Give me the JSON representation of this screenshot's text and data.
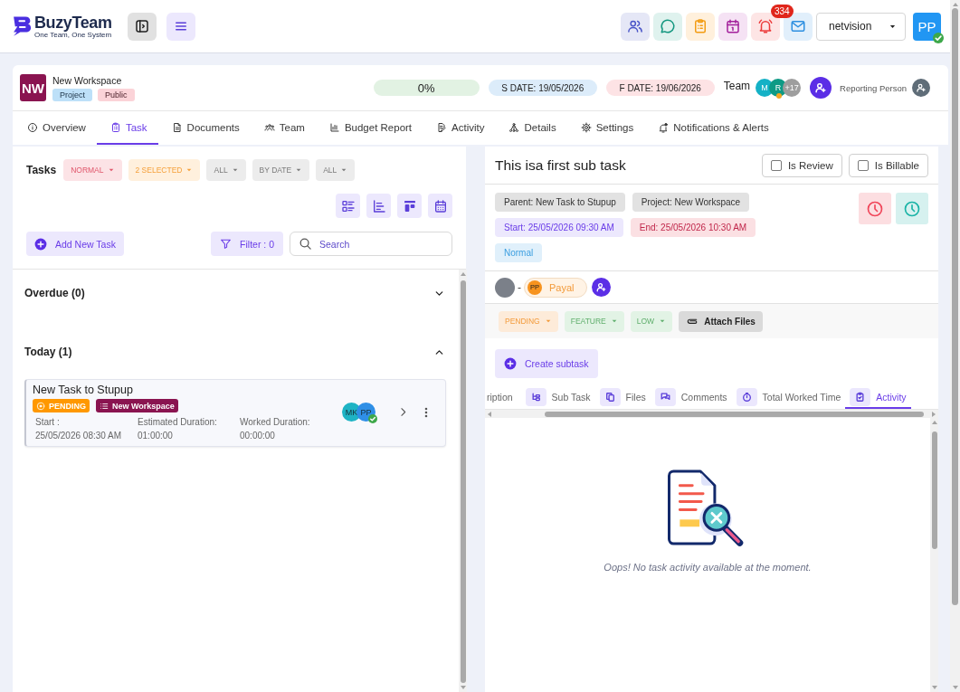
{
  "top_bar": {
    "brand": "BuzyTeam",
    "tagline": "One Team, One System",
    "actions": [
      {
        "kind": "team"
      },
      {
        "kind": "chat"
      },
      {
        "kind": "tasks"
      },
      {
        "kind": "calendar"
      },
      {
        "kind": "notifications",
        "badge": "334"
      },
      {
        "kind": "mail"
      }
    ],
    "workspace_select": {
      "value": "netvision"
    },
    "user": {
      "initials": "PP",
      "verified": true
    }
  },
  "workspace": {
    "initials": "NW",
    "name": "New Workspace",
    "tags": [
      {
        "label": "Project",
        "kind": "type"
      },
      {
        "label": "Public",
        "kind": "visibility"
      }
    ],
    "progress": "0%",
    "start_date": "S DATE: 19/05/2026",
    "finish_date": "F DATE: 19/06/2026",
    "team": {
      "label": "Team",
      "members": [
        {
          "initials": "M",
          "color": "#14b1c6",
          "away": false
        },
        {
          "initials": "R",
          "color": "#0e9a85",
          "away": true
        },
        {
          "initials": "+17",
          "color": "#9e9e9e",
          "away": false
        }
      ]
    },
    "reporting_person": "Reporting Person"
  },
  "tabs": [
    {
      "label": "Overview",
      "kind": "overview",
      "selected": false
    },
    {
      "label": "Task",
      "kind": "task",
      "selected": true
    },
    {
      "label": "Documents",
      "kind": "documents",
      "selected": false
    },
    {
      "label": "Team",
      "kind": "team",
      "selected": false
    },
    {
      "label": "Budget Report",
      "kind": "budget",
      "selected": false
    },
    {
      "label": "Activity",
      "kind": "activity",
      "selected": false
    },
    {
      "label": "Details",
      "kind": "details",
      "selected": false
    },
    {
      "label": "Settings",
      "kind": "settings",
      "selected": false
    },
    {
      "label": "Notifications & Alerts",
      "kind": "notifications",
      "selected": false
    }
  ],
  "tasks_panel": {
    "title": "Tasks",
    "filters": [
      {
        "label": "NORMAL",
        "kind": "priority"
      },
      {
        "label": "2 SELECTED",
        "kind": "status"
      },
      {
        "label": "ALL",
        "kind": "plain"
      },
      {
        "label": "BY DATE",
        "kind": "plain"
      },
      {
        "label": "ALL",
        "kind": "plain"
      }
    ],
    "views": [
      {
        "kind": "list"
      },
      {
        "kind": "gantt"
      },
      {
        "kind": "board"
      },
      {
        "kind": "calendar"
      }
    ],
    "add_button": "Add New Task",
    "filter_button": "Filter : 0",
    "search": {
      "placeholder": "Search"
    },
    "groups": [
      {
        "title": "Overdue (0)",
        "expanded": false
      },
      {
        "title": "Today (1)",
        "expanded": true,
        "tasks": [
          {
            "title": "New Task to Stupup",
            "status": "PENDING",
            "project": "New Workspace",
            "fields": [
              {
                "label": "Start :",
                "value": "25/05/2026 08:30 AM"
              },
              {
                "label": "Estimated Duration:",
                "value": "01:00:00"
              },
              {
                "label": "Worked Duration:",
                "value": "00:00:00"
              }
            ],
            "assignees": [
              {
                "initials": "MK",
                "color": "#1eb3c4",
                "verified": false
              },
              {
                "initials": "PP",
                "color": "#2f8fe6",
                "verified": true
              }
            ]
          }
        ]
      }
    ]
  },
  "subtask_panel": {
    "title": "This isa first sub task",
    "options": [
      {
        "label": "Is Review",
        "checked": false
      },
      {
        "label": "Is Billable",
        "checked": false
      }
    ],
    "info_rows": [
      [
        {
          "kind": "parent",
          "label": "Parent:",
          "value": "New Task to Stupup"
        },
        {
          "kind": "project",
          "label": "Project:",
          "value": "New Workspace"
        }
      ],
      [
        {
          "kind": "start",
          "label": "Start:",
          "value": "25/05/2026 09:30 AM"
        },
        {
          "kind": "end",
          "label": "End:",
          "value": "25/05/2026 10:30 AM"
        }
      ],
      [
        {
          "kind": "priority",
          "value": "Normal"
        }
      ]
    ],
    "timers": [
      {
        "color": "#f0465a"
      },
      {
        "color": "#19b3a6"
      }
    ],
    "owner_separator": "-",
    "assignees": [
      {
        "initials": "PP",
        "name": "Payal"
      }
    ],
    "dropdowns": [
      {
        "label": "PENDING",
        "kind": "status"
      },
      {
        "label": "FEATURE",
        "kind": "type"
      },
      {
        "label": "LOW",
        "kind": "priority"
      }
    ],
    "attach_button": "Attach Files",
    "create_button": "Create subtask",
    "detail_tabs": [
      {
        "label": "ription",
        "kind": "description",
        "selected": false
      },
      {
        "label": "Sub Task",
        "kind": "subtask",
        "selected": false
      },
      {
        "label": "Files",
        "kind": "files",
        "selected": false
      },
      {
        "label": "Comments",
        "kind": "comments",
        "selected": false
      },
      {
        "label": "Total Worked Time",
        "kind": "worked_time",
        "selected": false
      },
      {
        "label": "Activity",
        "kind": "activity",
        "selected": true
      }
    ],
    "empty_message": "Oops! No task activity available at the moment."
  }
}
